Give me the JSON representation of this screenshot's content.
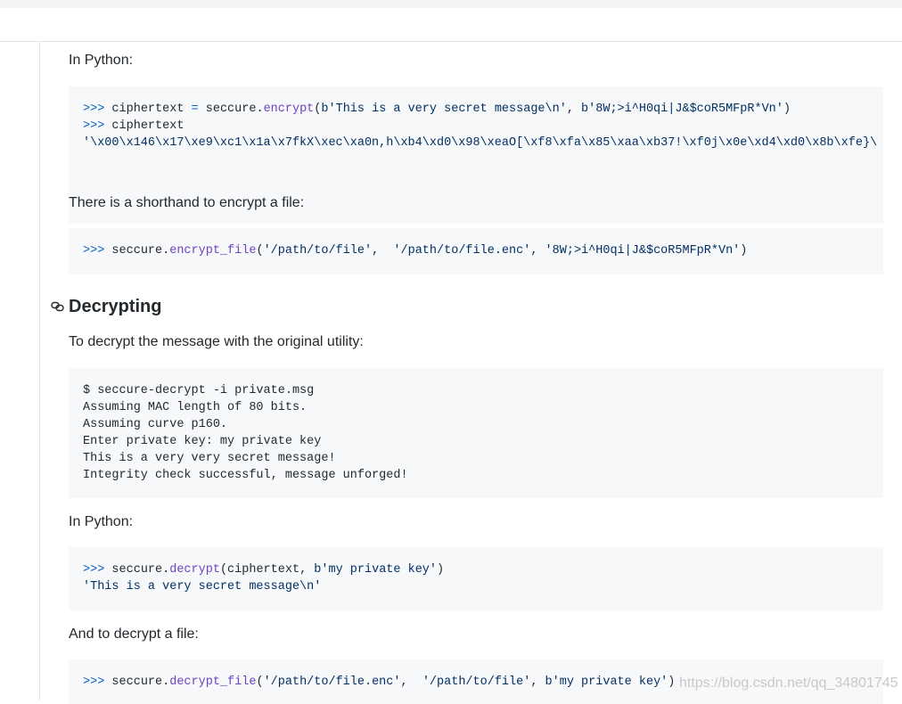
{
  "sections": {
    "p1": "In Python:",
    "p2": "There is a shorthand to encrypt a file:",
    "h_decrypt": "Decrypting",
    "p3": "To decrypt the message with the original utility:",
    "p4": "In Python:",
    "p5": "And to decrypt a file:"
  },
  "code1": {
    "line1": {
      "prompt": ">>>",
      "var": " ciphertext ",
      "eq": "=",
      "obj": " seccure.",
      "fn": "encrypt",
      "open": "(",
      "arg1": "b'This is a very secret message\\n'",
      "comma": ", ",
      "arg2": "b'8W;>i^H0qi|J&$coR5MFpR*Vn'",
      "close": ")"
    },
    "line2": {
      "prompt": ">>>",
      "text": " ciphertext"
    },
    "line3": "'\\x00\\x146\\x17\\xe9\\xc1\\x1a\\x7fkX\\xec\\xa0n,h\\xb4\\xd0\\x98\\xeaO[\\xf8\\xfa\\x85\\xaa\\xb37!\\xf0j\\x0e\\xd4\\xd0\\x8b\\xfe}\\"
  },
  "scrollbar": {
    "thumb_fraction": 0.58
  },
  "code2": {
    "prompt": ">>>",
    "obj": " seccure.",
    "fn": "encrypt_file",
    "open": "(",
    "arg1": "'/path/to/file'",
    "sep1": ",  ",
    "arg2": "'/path/to/file.enc'",
    "sep2": ", ",
    "arg3": "'8W;>i^H0qi|J&$coR5MFpR*Vn'",
    "close": ")"
  },
  "code3": {
    "lines": [
      "$ seccure-decrypt -i private.msg",
      "Assuming MAC length of 80 bits.",
      "Assuming curve p160.",
      "Enter private key: my private key",
      "This is a very very secret message!",
      "Integrity check successful, message unforged!"
    ]
  },
  "code4": {
    "line1": {
      "prompt": ">>>",
      "obj": " seccure.",
      "fn": "decrypt",
      "open": "(ciphertext, ",
      "arg": "b'my private key'",
      "close": ")"
    },
    "line2": "'This is a very secret message\\n'"
  },
  "code5": {
    "prompt": ">>>",
    "obj": " seccure.",
    "fn": "decrypt_file",
    "open": "(",
    "arg1": "'/path/to/file.enc'",
    "sep1": ",  ",
    "arg2": "'/path/to/file'",
    "sep2": ", ",
    "arg3": "b'my private key'",
    "close": ")"
  },
  "watermark": "https://blog.csdn.net/qq_34801745",
  "icons": {
    "anchor": "link-icon"
  },
  "colors": {
    "prompt": "#005cc5",
    "function": "#6f42c1",
    "string": "#032f62",
    "code_bg": "#f6f8fa"
  }
}
